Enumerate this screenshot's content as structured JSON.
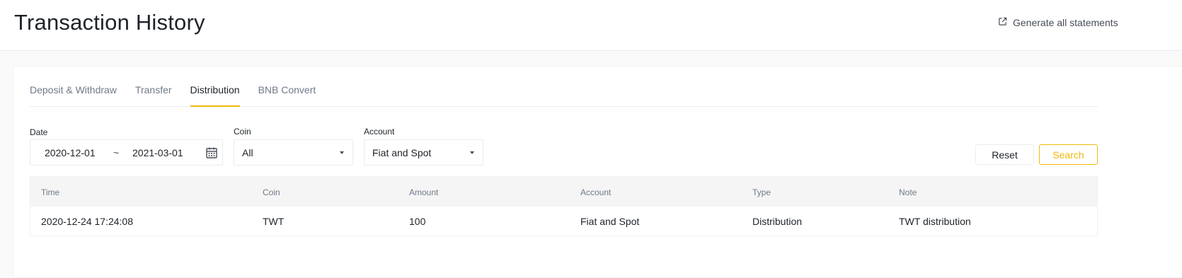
{
  "header": {
    "title": "Transaction History",
    "generate_label": "Generate all statements"
  },
  "tabs": [
    {
      "label": "Deposit & Withdraw",
      "active": false
    },
    {
      "label": "Transfer",
      "active": false
    },
    {
      "label": "Distribution",
      "active": true
    },
    {
      "label": "BNB Convert",
      "active": false
    }
  ],
  "filters": {
    "date": {
      "label": "Date",
      "start": "2020-12-01",
      "separator": "~",
      "end": "2021-03-01"
    },
    "coin": {
      "label": "Coin",
      "value": "All"
    },
    "account": {
      "label": "Account",
      "value": "Fiat and Spot"
    },
    "reset_label": "Reset",
    "search_label": "Search"
  },
  "table": {
    "columns": [
      "Time",
      "Coin",
      "Amount",
      "Account",
      "Type",
      "Note"
    ],
    "rows": [
      [
        "2020-12-24 17:24:08",
        "TWT",
        "100",
        "Fiat and Spot",
        "Distribution",
        "TWT distribution"
      ]
    ]
  },
  "colors": {
    "accent": "#f0b90b",
    "text_primary": "#1e2329",
    "text_secondary": "#707a8a",
    "header_bg": "#f5f5f5"
  },
  "icons": {
    "generate": "external-link-icon",
    "date": "calendar-icon",
    "dropdown": "caret-down-icon"
  }
}
